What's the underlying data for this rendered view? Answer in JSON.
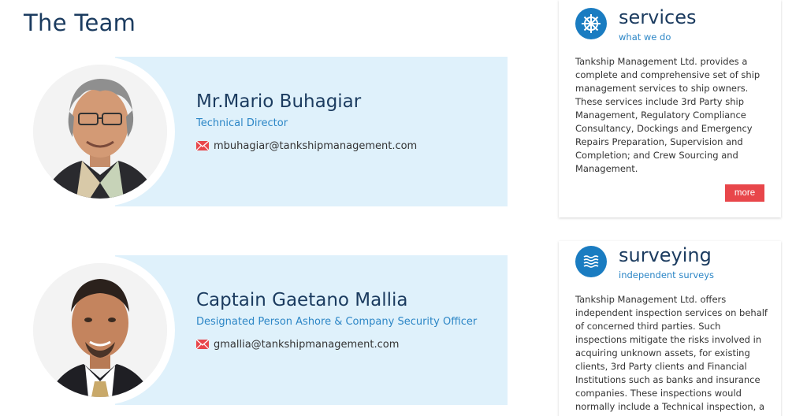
{
  "page_title": "The Team",
  "team": [
    {
      "name": "Mr.Mario Buhagiar",
      "role": "Technical Director",
      "email": "mbuhagiar@tankshipmanagement.com"
    },
    {
      "name": "Captain Gaetano Mallia",
      "role": "Designated Person Ashore & Company Security Officer",
      "email": "gmallia@tankshipmanagement.com"
    }
  ],
  "panels": [
    {
      "icon": "ship-wheel-icon",
      "title": "services",
      "subtitle": "what we do",
      "text": "Tankship Management Ltd. provides a complete and comprehensive set of ship management services to ship owners. These services include 3rd Party ship Management, Regulatory Compliance Consultancy, Dockings and Emergency Repairs Preparation, Supervision and Completion; and Crew Sourcing and Management.",
      "more_label": "more"
    },
    {
      "icon": "waves-icon",
      "title": "surveying",
      "subtitle": "independent surveys",
      "text": "Tankship Management Ltd. offers independent inspection services on behalf of concerned third parties. Such inspections mitigate the risks involved in acquiring unknown assets, for existing clients, 3rd Party clients and Financial Institutions such as banks and insurance companies. These inspections would normally include a Technical inspection, a"
    }
  ],
  "colors": {
    "title": "#1b3b5f",
    "accent": "#2c86c6",
    "card_bg": "#dff1fb",
    "icon_bg": "#1a7cc1",
    "button": "#e8464a"
  }
}
